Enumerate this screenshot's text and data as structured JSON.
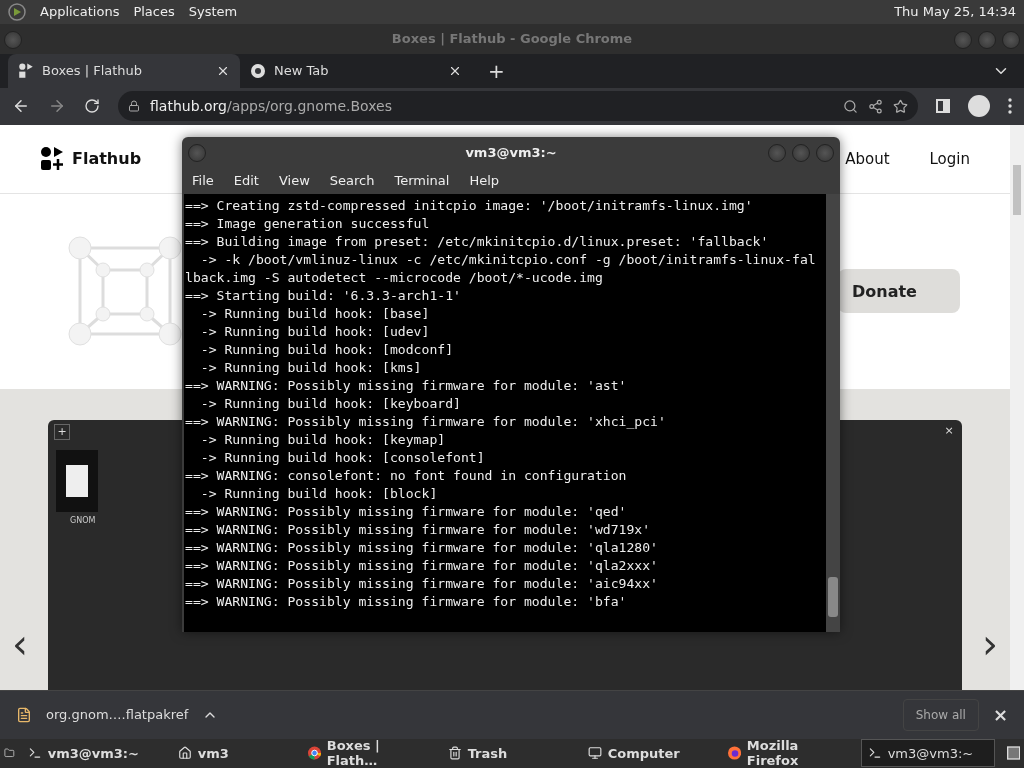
{
  "top_panel": {
    "menus": [
      "Applications",
      "Places",
      "System"
    ],
    "clock": "Thu May 25, 14:34"
  },
  "browser": {
    "title": "Boxes | Flathub - Google Chrome",
    "tabs": [
      {
        "label": "Boxes | Flathub",
        "selected": true,
        "kind": "site"
      },
      {
        "label": "New Tab",
        "selected": false,
        "kind": "newtab"
      }
    ],
    "new_tab": "+",
    "url": {
      "domain": "flathub.org",
      "path": "/apps/org.gnome.Boxes"
    },
    "page": {
      "brand": "Flathub",
      "nav": [
        "About",
        "Login"
      ],
      "donate": "Donate",
      "gallery": {
        "add": "+",
        "close": "×",
        "thumbnail_label": "GNOM",
        "prev": "‹",
        "next": "›"
      }
    },
    "download": {
      "file": "org.gnom….flatpakref",
      "show_all": "Show all",
      "close": "×"
    }
  },
  "terminal": {
    "title": "vm3@vm3:~",
    "menus": [
      "File",
      "Edit",
      "View",
      "Search",
      "Terminal",
      "Help"
    ],
    "lines": [
      "==> Creating zstd-compressed initcpio image: '/boot/initramfs-linux.img'",
      "==> Image generation successful",
      "==> Building image from preset: /etc/mkinitcpio.d/linux.preset: 'fallback'",
      "  -> -k /boot/vmlinuz-linux -c /etc/mkinitcpio.conf -g /boot/initramfs-linux-fal",
      "lback.img -S autodetect --microcode /boot/*-ucode.img",
      "==> Starting build: '6.3.3-arch1-1'",
      "  -> Running build hook: [base]",
      "  -> Running build hook: [udev]",
      "  -> Running build hook: [modconf]",
      "  -> Running build hook: [kms]",
      "==> WARNING: Possibly missing firmware for module: 'ast'",
      "  -> Running build hook: [keyboard]",
      "==> WARNING: Possibly missing firmware for module: 'xhci_pci'",
      "  -> Running build hook: [keymap]",
      "  -> Running build hook: [consolefont]",
      "==> WARNING: consolefont: no font found in configuration",
      "  -> Running build hook: [block]",
      "==> WARNING: Possibly missing firmware for module: 'qed'",
      "==> WARNING: Possibly missing firmware for module: 'wd719x'",
      "==> WARNING: Possibly missing firmware for module: 'qla1280'",
      "==> WARNING: Possibly missing firmware for module: 'qla2xxx'",
      "==> WARNING: Possibly missing firmware for module: 'aic94xx'",
      "==> WARNING: Possibly missing firmware for module: 'bfa'"
    ]
  },
  "taskbar": [
    {
      "label": "vm3@vm3:~",
      "kind": "terminal",
      "selected": false
    },
    {
      "label": "vm3",
      "kind": "folder",
      "selected": false
    },
    {
      "label": "Boxes | Flath…",
      "kind": "chrome",
      "selected": false
    },
    {
      "label": "Trash",
      "kind": "trash",
      "selected": false
    },
    {
      "label": "Computer",
      "kind": "computer",
      "selected": false
    },
    {
      "label": "Mozilla Firefox",
      "kind": "firefox",
      "selected": false
    },
    {
      "label": "vm3@vm3:~",
      "kind": "terminal",
      "selected": true
    }
  ]
}
